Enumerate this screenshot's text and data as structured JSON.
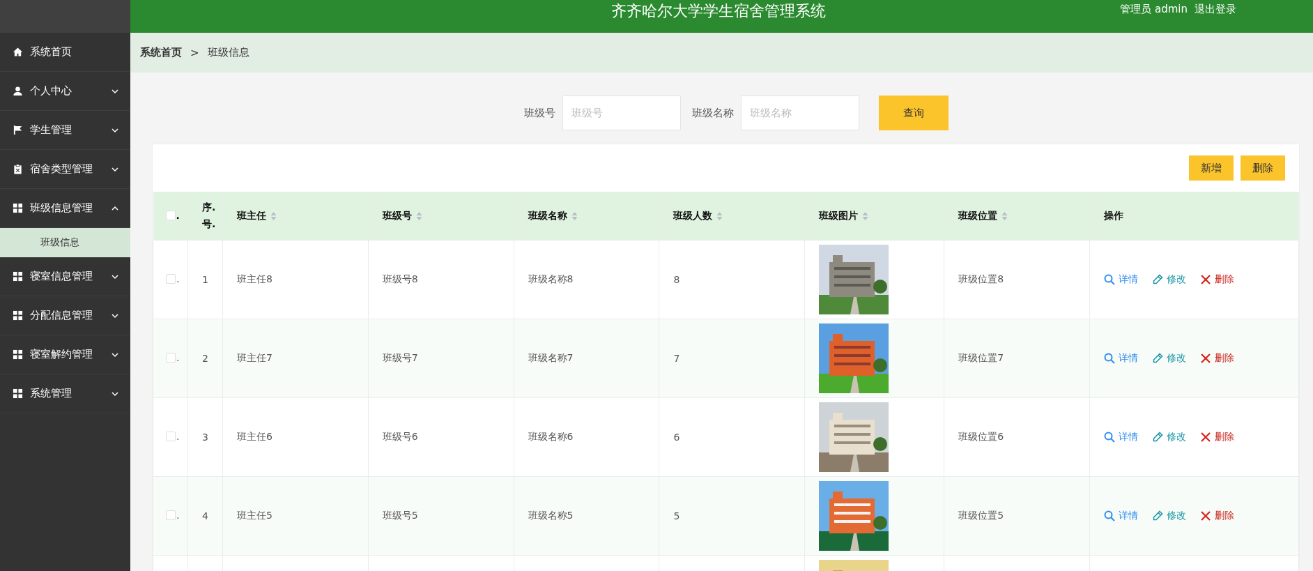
{
  "header": {
    "title": "齐齐哈尔大学学生宿舍管理系统",
    "user": "管理员 admin",
    "logout": "退出登录"
  },
  "sidebar": {
    "items": [
      {
        "label": "系统首页"
      },
      {
        "label": "个人中心",
        "expanded": false
      },
      {
        "label": "学生管理",
        "expanded": false
      },
      {
        "label": "宿舍类型管理",
        "expanded": false
      },
      {
        "label": "班级信息管理",
        "expanded": true,
        "children": [
          {
            "label": "班级信息",
            "selected": true
          }
        ]
      },
      {
        "label": "寝室信息管理",
        "expanded": false
      },
      {
        "label": "分配信息管理",
        "expanded": false
      },
      {
        "label": "寝室解约管理",
        "expanded": false
      },
      {
        "label": "系统管理",
        "expanded": false
      }
    ]
  },
  "breadcrumb": [
    "系统首页",
    ">",
    "班级信息"
  ],
  "search": {
    "fields": [
      {
        "label": "班级号",
        "placeholder": "班级号"
      },
      {
        "label": "班级名称",
        "placeholder": "班级名称"
      }
    ],
    "button": "查询"
  },
  "toolbar": [
    "新增",
    "删除"
  ],
  "table": {
    "columns": [
      {
        "label": ".",
        "kind": "check",
        "checked": false
      },
      {
        "label": "序.号.",
        "kind": "index"
      },
      {
        "label": "班主任",
        "sortable": true
      },
      {
        "label": "班级号",
        "sortable": true
      },
      {
        "label": "班级名称",
        "sortable": true
      },
      {
        "label": "班级人数",
        "sortable": true
      },
      {
        "label": "班级图片",
        "sortable": true
      },
      {
        "label": "班级位置",
        "sortable": true
      },
      {
        "label": "操作",
        "sortable": false
      }
    ],
    "rows": [
      {
        "checked": false,
        "check_mark": ".",
        "index": "1",
        "teacher": "班主任8",
        "class_no": "班级号8",
        "class_name": "班级名称8",
        "count": "8",
        "image": {
          "kind": "picture"
        },
        "location": "班级位置8",
        "actions": [
          "详情",
          "修改",
          "删除"
        ]
      },
      {
        "checked": false,
        "check_mark": ".",
        "index": "2",
        "teacher": "班主任7",
        "class_no": "班级号7",
        "class_name": "班级名称7",
        "count": "7",
        "image": {
          "kind": "picture"
        },
        "location": "班级位置7",
        "actions": [
          "详情",
          "修改",
          "删除"
        ]
      },
      {
        "checked": false,
        "check_mark": ".",
        "index": "3",
        "teacher": "班主任6",
        "class_no": "班级号6",
        "class_name": "班级名称6",
        "count": "6",
        "image": {
          "kind": "picture"
        },
        "location": "班级位置6",
        "actions": [
          "详情",
          "修改",
          "删除"
        ]
      },
      {
        "checked": false,
        "check_mark": ".",
        "index": "4",
        "teacher": "班主任5",
        "class_no": "班级号5",
        "class_name": "班级名称5",
        "count": "5",
        "image": {
          "kind": "picture"
        },
        "location": "班级位置5",
        "actions": [
          "详情",
          "修改",
          "删除"
        ]
      },
      {
        "image": {
          "kind": "picture"
        }
      }
    ]
  }
}
